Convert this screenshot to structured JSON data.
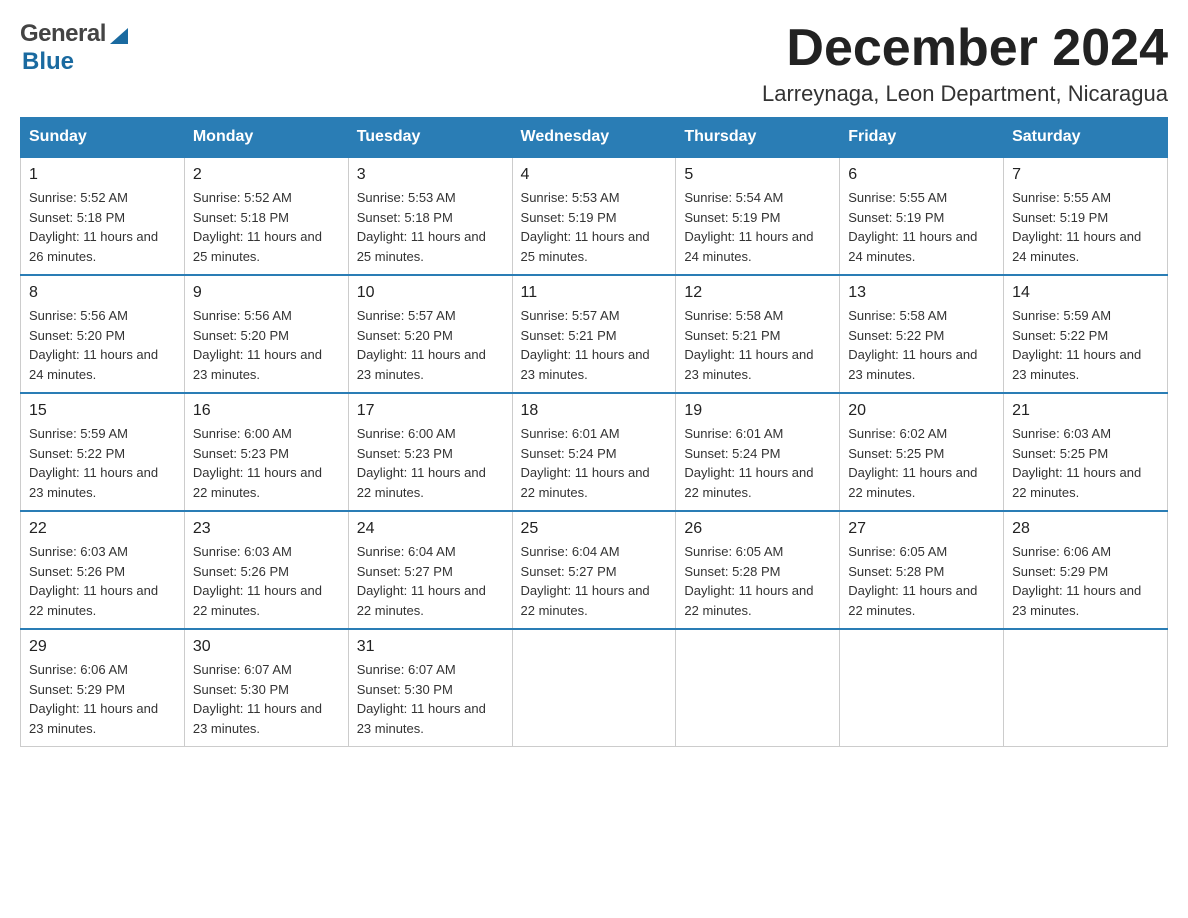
{
  "header": {
    "title": "December 2024",
    "subtitle": "Larreynaga, Leon Department, Nicaragua",
    "logo_general": "General",
    "logo_blue": "Blue"
  },
  "calendar": {
    "days_of_week": [
      "Sunday",
      "Monday",
      "Tuesday",
      "Wednesday",
      "Thursday",
      "Friday",
      "Saturday"
    ],
    "weeks": [
      [
        {
          "day": "1",
          "sunrise": "Sunrise: 5:52 AM",
          "sunset": "Sunset: 5:18 PM",
          "daylight": "Daylight: 11 hours and 26 minutes."
        },
        {
          "day": "2",
          "sunrise": "Sunrise: 5:52 AM",
          "sunset": "Sunset: 5:18 PM",
          "daylight": "Daylight: 11 hours and 25 minutes."
        },
        {
          "day": "3",
          "sunrise": "Sunrise: 5:53 AM",
          "sunset": "Sunset: 5:18 PM",
          "daylight": "Daylight: 11 hours and 25 minutes."
        },
        {
          "day": "4",
          "sunrise": "Sunrise: 5:53 AM",
          "sunset": "Sunset: 5:19 PM",
          "daylight": "Daylight: 11 hours and 25 minutes."
        },
        {
          "day": "5",
          "sunrise": "Sunrise: 5:54 AM",
          "sunset": "Sunset: 5:19 PM",
          "daylight": "Daylight: 11 hours and 24 minutes."
        },
        {
          "day": "6",
          "sunrise": "Sunrise: 5:55 AM",
          "sunset": "Sunset: 5:19 PM",
          "daylight": "Daylight: 11 hours and 24 minutes."
        },
        {
          "day": "7",
          "sunrise": "Sunrise: 5:55 AM",
          "sunset": "Sunset: 5:19 PM",
          "daylight": "Daylight: 11 hours and 24 minutes."
        }
      ],
      [
        {
          "day": "8",
          "sunrise": "Sunrise: 5:56 AM",
          "sunset": "Sunset: 5:20 PM",
          "daylight": "Daylight: 11 hours and 24 minutes."
        },
        {
          "day": "9",
          "sunrise": "Sunrise: 5:56 AM",
          "sunset": "Sunset: 5:20 PM",
          "daylight": "Daylight: 11 hours and 23 minutes."
        },
        {
          "day": "10",
          "sunrise": "Sunrise: 5:57 AM",
          "sunset": "Sunset: 5:20 PM",
          "daylight": "Daylight: 11 hours and 23 minutes."
        },
        {
          "day": "11",
          "sunrise": "Sunrise: 5:57 AM",
          "sunset": "Sunset: 5:21 PM",
          "daylight": "Daylight: 11 hours and 23 minutes."
        },
        {
          "day": "12",
          "sunrise": "Sunrise: 5:58 AM",
          "sunset": "Sunset: 5:21 PM",
          "daylight": "Daylight: 11 hours and 23 minutes."
        },
        {
          "day": "13",
          "sunrise": "Sunrise: 5:58 AM",
          "sunset": "Sunset: 5:22 PM",
          "daylight": "Daylight: 11 hours and 23 minutes."
        },
        {
          "day": "14",
          "sunrise": "Sunrise: 5:59 AM",
          "sunset": "Sunset: 5:22 PM",
          "daylight": "Daylight: 11 hours and 23 minutes."
        }
      ],
      [
        {
          "day": "15",
          "sunrise": "Sunrise: 5:59 AM",
          "sunset": "Sunset: 5:22 PM",
          "daylight": "Daylight: 11 hours and 23 minutes."
        },
        {
          "day": "16",
          "sunrise": "Sunrise: 6:00 AM",
          "sunset": "Sunset: 5:23 PM",
          "daylight": "Daylight: 11 hours and 22 minutes."
        },
        {
          "day": "17",
          "sunrise": "Sunrise: 6:00 AM",
          "sunset": "Sunset: 5:23 PM",
          "daylight": "Daylight: 11 hours and 22 minutes."
        },
        {
          "day": "18",
          "sunrise": "Sunrise: 6:01 AM",
          "sunset": "Sunset: 5:24 PM",
          "daylight": "Daylight: 11 hours and 22 minutes."
        },
        {
          "day": "19",
          "sunrise": "Sunrise: 6:01 AM",
          "sunset": "Sunset: 5:24 PM",
          "daylight": "Daylight: 11 hours and 22 minutes."
        },
        {
          "day": "20",
          "sunrise": "Sunrise: 6:02 AM",
          "sunset": "Sunset: 5:25 PM",
          "daylight": "Daylight: 11 hours and 22 minutes."
        },
        {
          "day": "21",
          "sunrise": "Sunrise: 6:03 AM",
          "sunset": "Sunset: 5:25 PM",
          "daylight": "Daylight: 11 hours and 22 minutes."
        }
      ],
      [
        {
          "day": "22",
          "sunrise": "Sunrise: 6:03 AM",
          "sunset": "Sunset: 5:26 PM",
          "daylight": "Daylight: 11 hours and 22 minutes."
        },
        {
          "day": "23",
          "sunrise": "Sunrise: 6:03 AM",
          "sunset": "Sunset: 5:26 PM",
          "daylight": "Daylight: 11 hours and 22 minutes."
        },
        {
          "day": "24",
          "sunrise": "Sunrise: 6:04 AM",
          "sunset": "Sunset: 5:27 PM",
          "daylight": "Daylight: 11 hours and 22 minutes."
        },
        {
          "day": "25",
          "sunrise": "Sunrise: 6:04 AM",
          "sunset": "Sunset: 5:27 PM",
          "daylight": "Daylight: 11 hours and 22 minutes."
        },
        {
          "day": "26",
          "sunrise": "Sunrise: 6:05 AM",
          "sunset": "Sunset: 5:28 PM",
          "daylight": "Daylight: 11 hours and 22 minutes."
        },
        {
          "day": "27",
          "sunrise": "Sunrise: 6:05 AM",
          "sunset": "Sunset: 5:28 PM",
          "daylight": "Daylight: 11 hours and 22 minutes."
        },
        {
          "day": "28",
          "sunrise": "Sunrise: 6:06 AM",
          "sunset": "Sunset: 5:29 PM",
          "daylight": "Daylight: 11 hours and 23 minutes."
        }
      ],
      [
        {
          "day": "29",
          "sunrise": "Sunrise: 6:06 AM",
          "sunset": "Sunset: 5:29 PM",
          "daylight": "Daylight: 11 hours and 23 minutes."
        },
        {
          "day": "30",
          "sunrise": "Sunrise: 6:07 AM",
          "sunset": "Sunset: 5:30 PM",
          "daylight": "Daylight: 11 hours and 23 minutes."
        },
        {
          "day": "31",
          "sunrise": "Sunrise: 6:07 AM",
          "sunset": "Sunset: 5:30 PM",
          "daylight": "Daylight: 11 hours and 23 minutes."
        },
        null,
        null,
        null,
        null
      ]
    ]
  }
}
